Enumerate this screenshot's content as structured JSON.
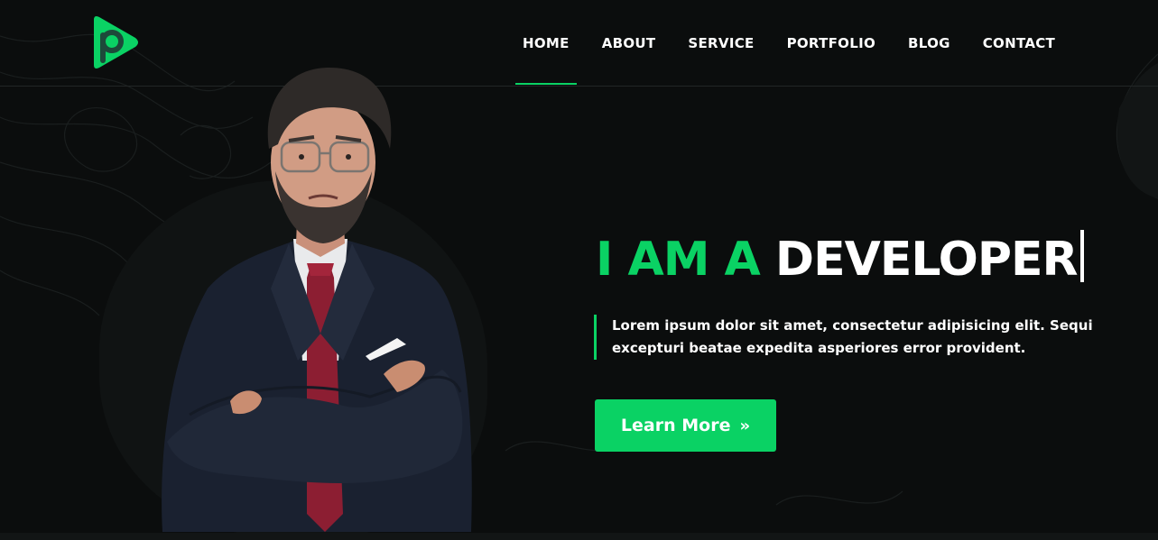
{
  "brand": {
    "logo_letter": "P",
    "accent_color": "#0ad264",
    "background_color": "#0b0d0d"
  },
  "nav": {
    "items": [
      {
        "label": "HOME",
        "active": true
      },
      {
        "label": "ABOUT",
        "active": false
      },
      {
        "label": "SERVICE",
        "active": false
      },
      {
        "label": "PORTFOLIO",
        "active": false
      },
      {
        "label": "BLOG",
        "active": false
      },
      {
        "label": "CONTACT",
        "active": false
      }
    ]
  },
  "hero": {
    "headline_prefix": "I AM A",
    "headline_role": "DEVELOPER",
    "description": "Lorem ipsum dolor sit amet, consectetur adipisicing elit. Sequi excepturi beatae expedita asperiores error provident.",
    "cta_label": "Learn More",
    "cta_icon": "double-chevron-right-icon",
    "portrait": "man-in-suit-with-glasses-arms-crossed"
  }
}
